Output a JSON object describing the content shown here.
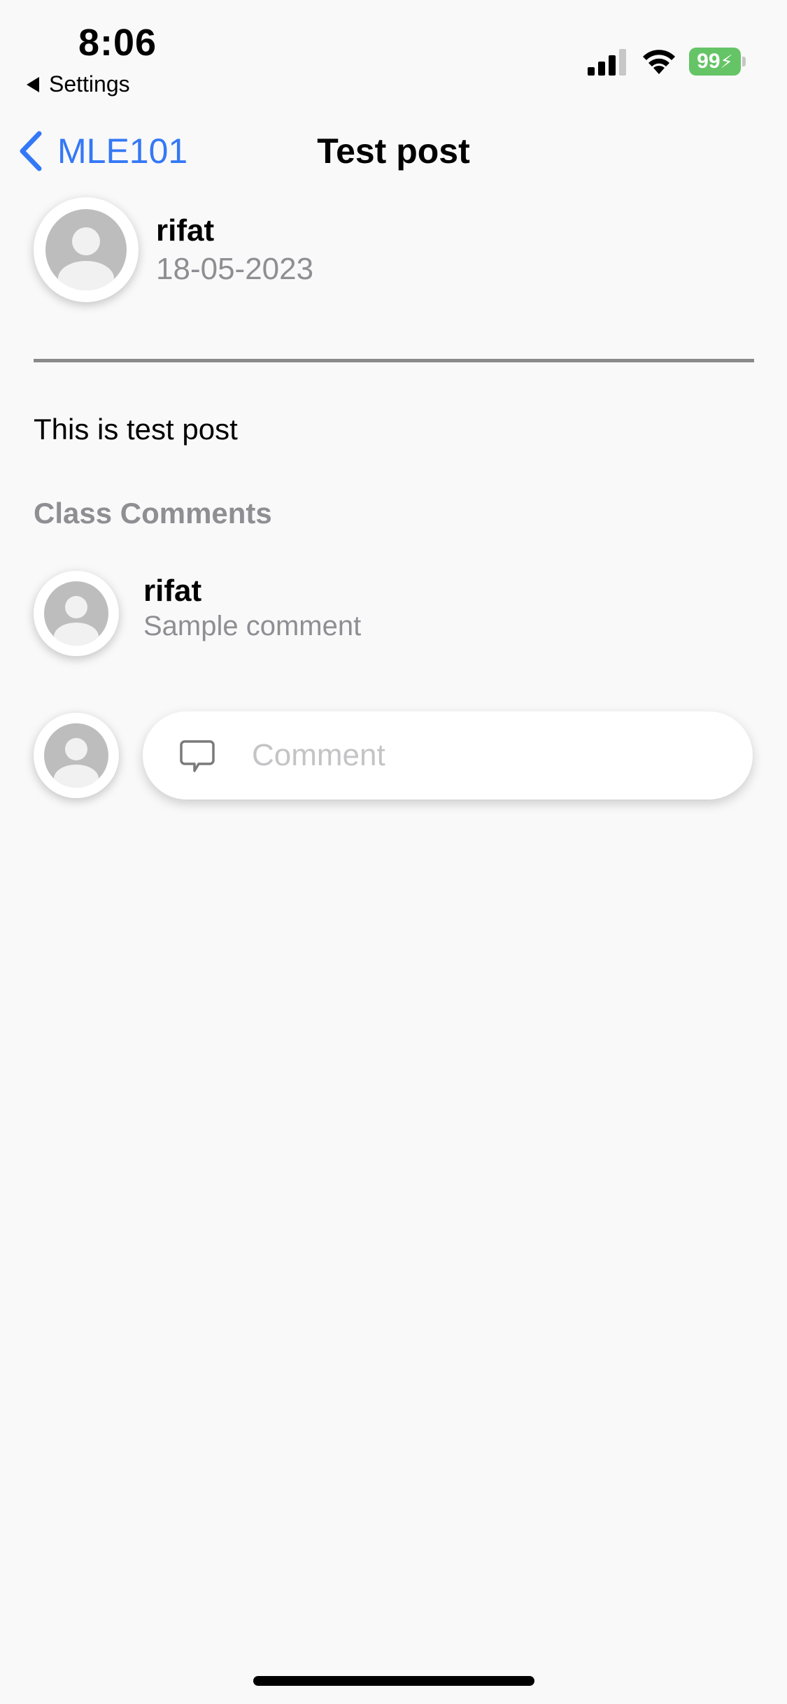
{
  "status_bar": {
    "time": "8:06",
    "back_app_label": "Settings",
    "battery_level": "99",
    "battery_color": "#65c466",
    "signal_icon": "cellular-signal-icon",
    "wifi_icon": "wifi-icon"
  },
  "nav": {
    "back_label": "MLE101",
    "title": "Test post",
    "accent_color": "#3478f6"
  },
  "post": {
    "author": "rifat",
    "date": "18-05-2023",
    "body": "This is test post"
  },
  "comments_section": {
    "header": "Class Comments",
    "items": [
      {
        "author": "rifat",
        "text": "Sample comment"
      }
    ]
  },
  "comment_input": {
    "placeholder": "Comment",
    "value": ""
  }
}
